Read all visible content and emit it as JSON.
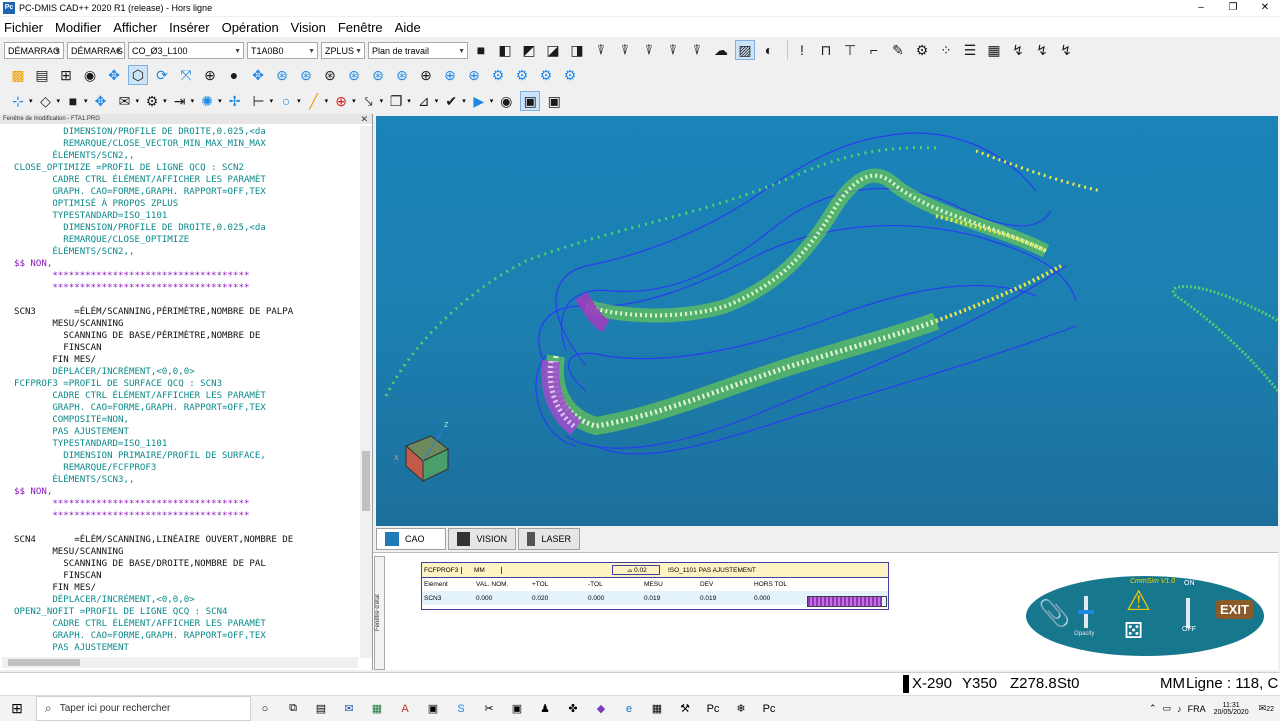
{
  "window": {
    "title": "PC-DMIS CAD++ 2020 R1 (release) - Hors ligne",
    "app_icon": "Pc"
  },
  "menu": [
    "Fichier",
    "Modifier",
    "Afficher",
    "Insérer",
    "Opération",
    "Vision",
    "Fenêtre",
    "Aide"
  ],
  "toolbar1": {
    "combos": [
      "DÉMARRAG",
      "DÉMARRAG",
      "CO_Ø3_L100",
      "T1A0B0",
      "ZPLUS",
      "Plan de travail"
    ]
  },
  "edit_panel": {
    "title": "Fenêtre de modification - FTA1.PRG",
    "lines": [
      {
        "t": "         DIMENSION/PROFILE DE DROITE,0.025,<da",
        "c": "t"
      },
      {
        "t": "         REMARQUE/CLOSE_VECTOR_MIN_MAX_MIN_MAX",
        "c": "t"
      },
      {
        "t": "       ÉLÉMENTS/SCN2,,",
        "c": "t"
      },
      {
        "t": "CLOSE_OPTIMIZE =PROFIL DE LIGNE QCQ : SCN2",
        "c": "t"
      },
      {
        "t": "       CADRE CTRL ÉLÉMENT/AFFICHER LES PARAMÈT",
        "c": "t"
      },
      {
        "t": "       GRAPH. CAO=FORME,GRAPH. RAPPORT=OFF,TEX",
        "c": "t"
      },
      {
        "t": "       OPTIMISÉ À PROPOS ZPLUS",
        "c": "t"
      },
      {
        "t": "       TYPESTANDARD=ISO_1101",
        "c": "t"
      },
      {
        "t": "         DIMENSION/PROFILE DE DROITE,0.025,<da",
        "c": "t"
      },
      {
        "t": "         REMARQUE/CLOSE_OPTIMIZE",
        "c": "t"
      },
      {
        "t": "       ÉLÉMENTS/SCN2,,",
        "c": "t"
      },
      {
        "t": "$$ NON,",
        "c": "p"
      },
      {
        "t": "       ************************************",
        "c": "p"
      },
      {
        "t": "       ************************************",
        "c": "p"
      },
      {
        "t": "",
        "c": "b"
      },
      {
        "t": "SCN3       =ÉLÉM/SCANNING,PÉRIMÈTRE,NOMBRE DE PALPA",
        "c": "b"
      },
      {
        "t": "       MESU/SCANNING",
        "c": "b"
      },
      {
        "t": "         SCANNING DE BASE/PÉRIMÈTRE,NOMBRE DE",
        "c": "b"
      },
      {
        "t": "         FINSCAN",
        "c": "b"
      },
      {
        "t": "       FIN MES/",
        "c": "b"
      },
      {
        "t": "       DÉPLACER/INCRÉMENT,<0,0,0>",
        "c": "t"
      },
      {
        "t": "FCFPROF3 =PROFIL DE SURFACE QCQ : SCN3",
        "c": "t"
      },
      {
        "t": "       CADRE CTRL ÉLÉMENT/AFFICHER LES PARAMÈT",
        "c": "t"
      },
      {
        "t": "       GRAPH. CAO=FORME,GRAPH. RAPPORT=OFF,TEX",
        "c": "t"
      },
      {
        "t": "       COMPOSITE=NON,",
        "c": "t"
      },
      {
        "t": "       PAS AJUSTEMENT",
        "c": "t"
      },
      {
        "t": "       TYPESTANDARD=ISO_1101",
        "c": "t"
      },
      {
        "t": "         DIMENSION PRIMAIRE/PROFIL DE SURFACE,",
        "c": "t"
      },
      {
        "t": "         REMARQUE/FCFPROF3",
        "c": "t"
      },
      {
        "t": "       ÉLÉMENTS/SCN3,,",
        "c": "t"
      },
      {
        "t": "$$ NON,",
        "c": "p"
      },
      {
        "t": "       ************************************",
        "c": "p"
      },
      {
        "t": "       ************************************",
        "c": "p"
      },
      {
        "t": "",
        "c": "b"
      },
      {
        "t": "SCN4       =ÉLÉM/SCANNING,LINÉAIRE OUVERT,NOMBRE DE",
        "c": "b"
      },
      {
        "t": "       MESU/SCANNING",
        "c": "b"
      },
      {
        "t": "         SCANNING DE BASE/DROITE,NOMBRE DE PAL",
        "c": "b"
      },
      {
        "t": "         FINSCAN",
        "c": "b"
      },
      {
        "t": "       FIN MES/",
        "c": "b"
      },
      {
        "t": "       DÉPLACER/INCRÉMENT,<0,0,0>",
        "c": "t"
      },
      {
        "t": "OPEN2_NOFIT =PROFIL DE LIGNE QCQ : SCN4",
        "c": "t"
      },
      {
        "t": "       CADRE CTRL ÉLÉMENT/AFFICHER LES PARAMÈT",
        "c": "t"
      },
      {
        "t": "       GRAPH. CAO=FORME,GRAPH. RAPPORT=OFF,TEX",
        "c": "t"
      },
      {
        "t": "       PAS AJUSTEMENT",
        "c": "t"
      }
    ]
  },
  "view_tabs": [
    "CAO",
    "VISION",
    "LASER"
  ],
  "status_table": {
    "feature": "FCFPROF3",
    "unit": "MM",
    "tolerance": "0.02",
    "standard": "ISO_1101  PAS AJUSTEMENT",
    "headers": [
      "Élément",
      "VAL. NOM.",
      "+TOL",
      "-TOL",
      "MESU",
      "DÉV",
      "HORS TOL"
    ],
    "row": [
      "SCN3",
      "0.000",
      "0.020",
      "0.000",
      "0.019",
      "0.019",
      "0.000"
    ],
    "deviation_fill": 0.95
  },
  "cmm_widget": {
    "title": "CmmSim V1.0",
    "on": "ON",
    "off": "OFF",
    "opacity": "Opacity",
    "exit": "EXIT"
  },
  "statusbar": {
    "x": "X-290",
    "y": "Y350",
    "z": "Z278.8",
    "s": "St0",
    "units": "MM",
    "line": "Ligne : 118, C"
  },
  "taskbar": {
    "search_placeholder": "Taper ici pour rechercher",
    "lang": "FRA",
    "time": "11:31",
    "date": "20/05/2020",
    "notif": "22"
  },
  "colors": {
    "viewport": "#1a83b8",
    "accent": "#1e88e5",
    "code_teal": "#0a8a8a",
    "code_purple": "#8b1ac0"
  }
}
